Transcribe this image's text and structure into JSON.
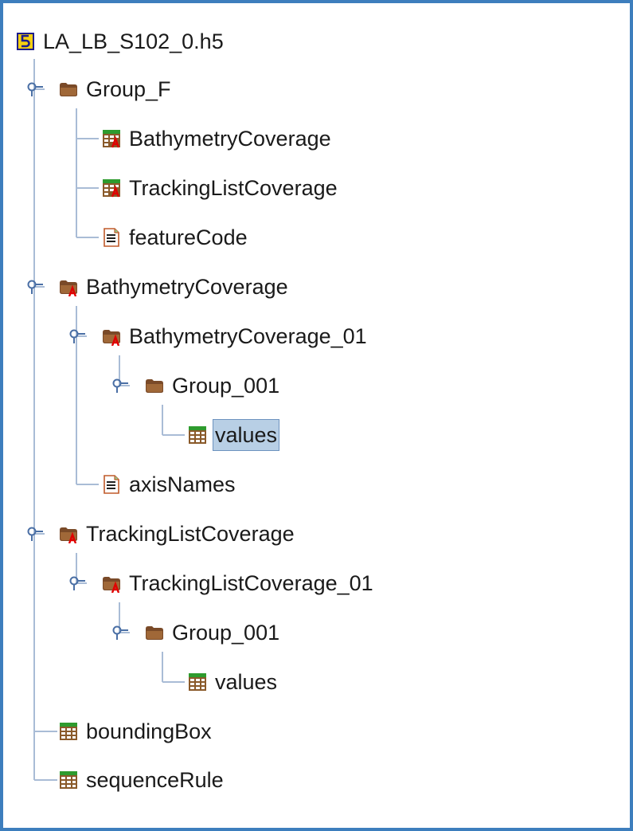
{
  "tree": {
    "root": {
      "label": "LA_LB_S102_0.h5",
      "icon": "hdf5-file-icon"
    },
    "nodes": [
      {
        "label": "Group_F",
        "icon": "folder-icon",
        "expanded": true
      },
      {
        "label": "BathymetryCoverage",
        "icon": "table-attribute-icon"
      },
      {
        "label": "TrackingListCoverage",
        "icon": "table-attribute-icon"
      },
      {
        "label": "featureCode",
        "icon": "text-dataset-icon"
      },
      {
        "label": "BathymetryCoverage",
        "icon": "folder-attribute-icon",
        "expanded": true
      },
      {
        "label": "BathymetryCoverage_01",
        "icon": "folder-attribute-icon",
        "expanded": true
      },
      {
        "label": "Group_001",
        "icon": "folder-icon",
        "expanded": true
      },
      {
        "label": "values",
        "icon": "table-icon",
        "selected": true
      },
      {
        "label": "axisNames",
        "icon": "text-dataset-icon"
      },
      {
        "label": "TrackingListCoverage",
        "icon": "folder-attribute-icon",
        "expanded": true
      },
      {
        "label": "TrackingListCoverage_01",
        "icon": "folder-attribute-icon",
        "expanded": true
      },
      {
        "label": "Group_001",
        "icon": "folder-icon",
        "expanded": true
      },
      {
        "label": "values",
        "icon": "table-icon"
      },
      {
        "label": "boundingBox",
        "icon": "table-icon"
      },
      {
        "label": "sequenceRule",
        "icon": "table-icon"
      }
    ]
  },
  "colors": {
    "frame_border": "#3d7ebd",
    "tree_line": "#a9bcd6",
    "selection_fill": "#b8cfe5",
    "selection_border": "#6d93bf"
  }
}
